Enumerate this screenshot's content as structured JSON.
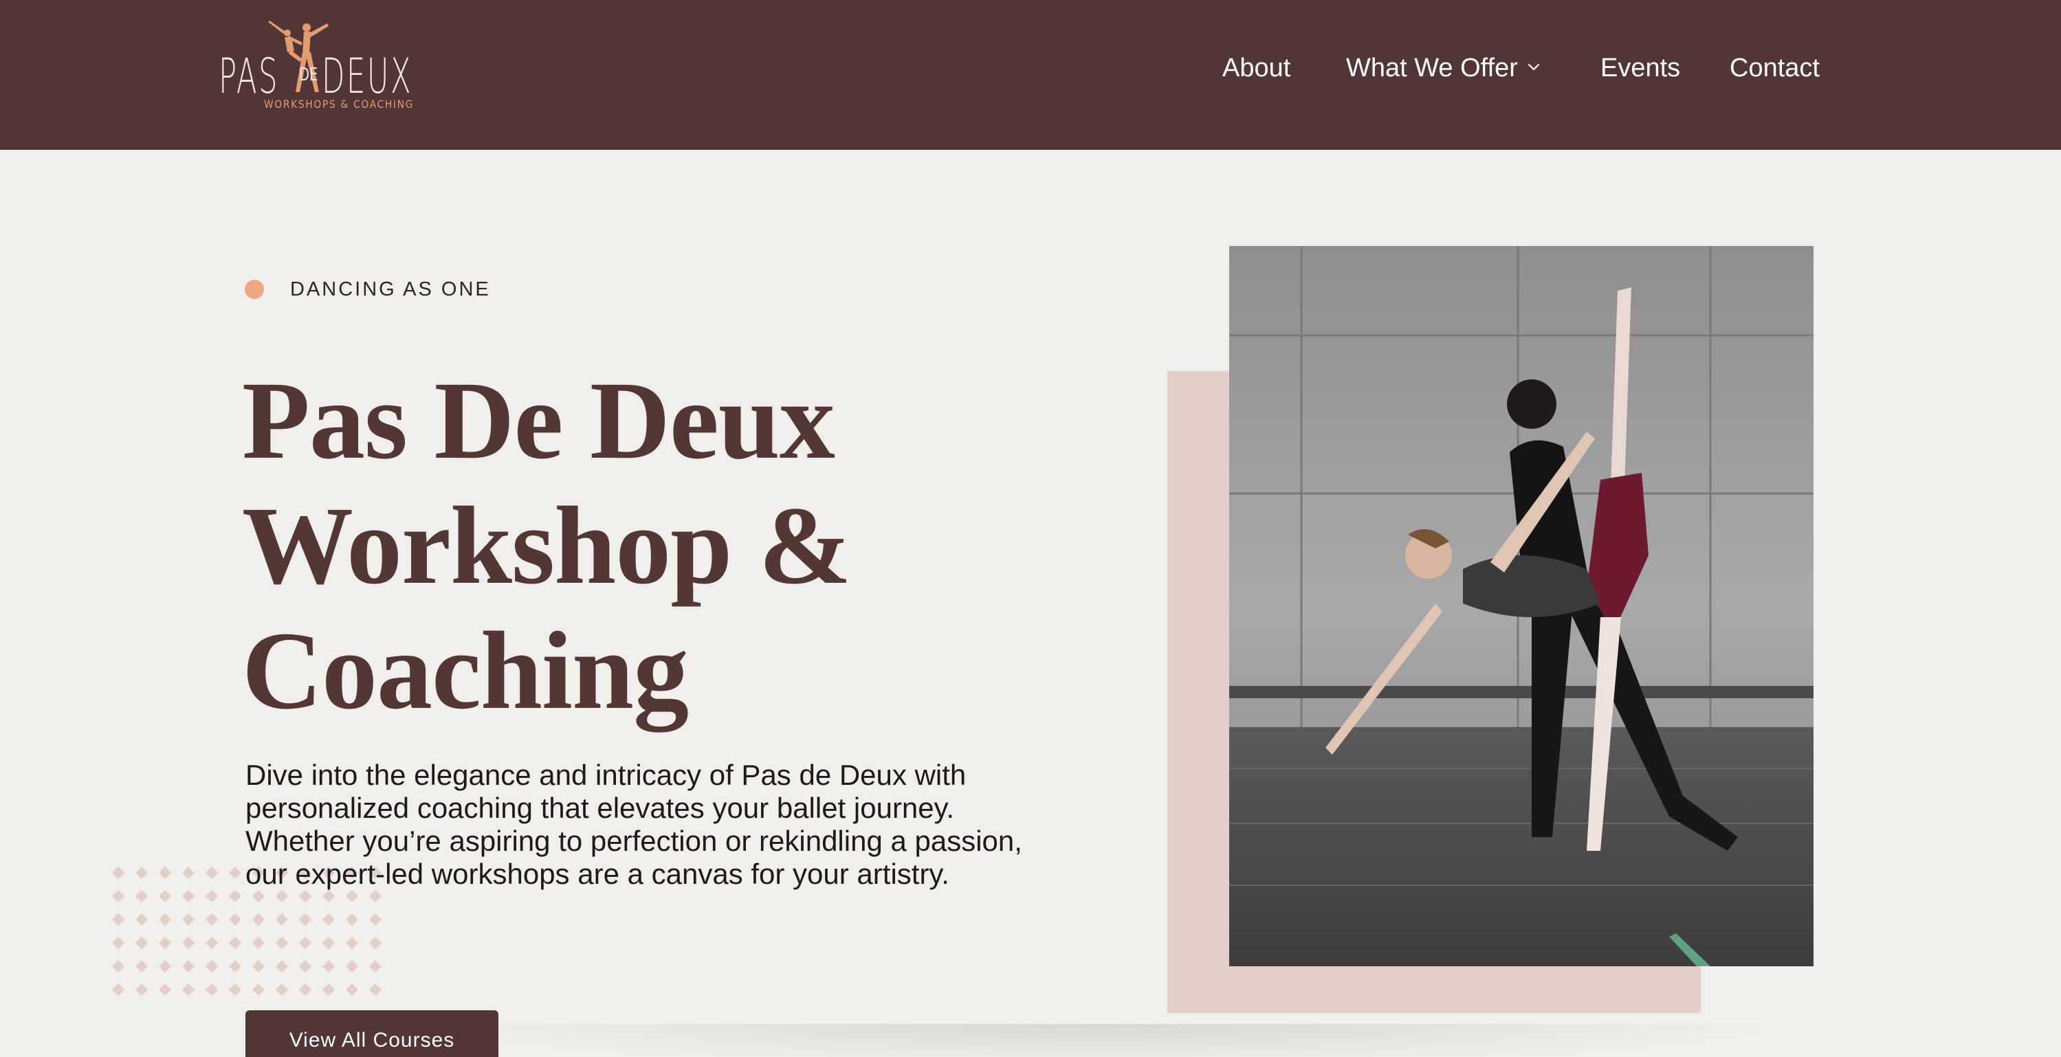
{
  "header": {
    "logo": {
      "word_left": "PAS",
      "word_small": "DE",
      "word_right": "DEUX",
      "tagline": "WORKSHOPS & COACHING",
      "icon": "dancers-logo-icon"
    },
    "nav": {
      "about": "About",
      "what_we_offer": "What We Offer",
      "events": "Events",
      "contact": "Contact",
      "dropdown_icon": "chevron-down-icon"
    }
  },
  "hero": {
    "eyebrow": "DANCING AS ONE",
    "title_line1": "Pas De Deux",
    "title_line2": "Workshop &",
    "title_line3": "Coaching",
    "description": "Dive into the elegance and intricacy of Pas de Deux with personalized coaching that elevates your ballet journey. Whether you’re aspiring to perfection or rekindling a passion, our expert-led workshops are a canvas for your artistry.",
    "cta_label": "View All Courses",
    "image": "ballet-pas-de-deux-photo"
  },
  "colors": {
    "brand": "#523635",
    "accent": "#eea784",
    "background": "#f1efeb",
    "backdrop": "#e2cfc7"
  }
}
